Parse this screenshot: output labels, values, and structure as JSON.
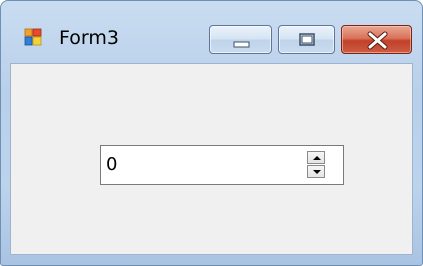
{
  "window": {
    "title": "Form3",
    "icon": "form-window-icon",
    "controls": {
      "minimize_icon": "minimize-icon",
      "maximize_icon": "maximize-icon",
      "close_icon": "close-icon"
    }
  },
  "form": {
    "numeric_updown": {
      "value": "0",
      "up_icon": "up-arrow-icon",
      "down_icon": "down-arrow-icon"
    }
  },
  "colors": {
    "frame": "#b9d0ea",
    "client": "#f0f0f0",
    "close_button": "#c2402a"
  }
}
